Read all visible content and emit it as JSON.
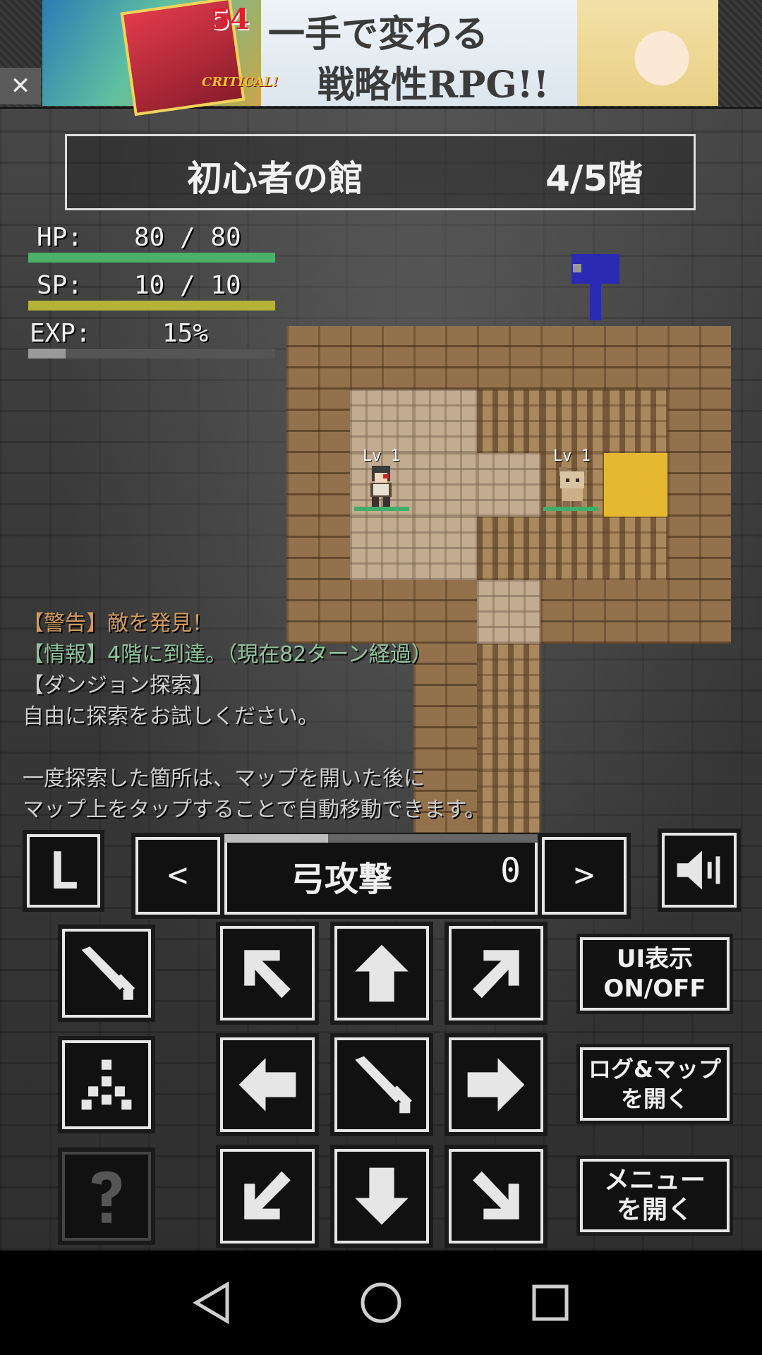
{
  "ad": {
    "badge": "54",
    "critical": "CRITICAL!",
    "line1": "一手で変わる",
    "line2": "戦略性RPG!!",
    "close": "✕"
  },
  "floor": {
    "name": "初心者の館",
    "count": "4/5階"
  },
  "stats": {
    "hp": {
      "label": "HP:",
      "value": "80 / 80",
      "fraction": 1.0,
      "color": "#4caf6a"
    },
    "sp": {
      "label": "SP:",
      "value": "10 / 10",
      "fraction": 1.0,
      "color": "#b5b23a"
    },
    "exp": {
      "label": "EXP:",
      "value": "15%",
      "fraction": 0.15,
      "color": "#9a9a9a"
    }
  },
  "units": {
    "player_level": "Lv 1",
    "enemy_level": "Lv 1"
  },
  "log": [
    {
      "text": "【警告】敵を発見！",
      "color": "#d29a5c"
    },
    {
      "text": "【情報】4階に到達。（現在82ターン経過）",
      "color": "#8fc49a"
    },
    {
      "text": "【ダンジョン探索】",
      "color": "#cfcfcf"
    },
    {
      "text": "自由に探索をお試しください。",
      "color": "#cfcfcf"
    },
    {
      "text": "",
      "color": "#cfcfcf"
    },
    {
      "text": "一度探索した箇所は、マップを開いた後に",
      "color": "#cfcfcf"
    },
    {
      "text": "マップ上をタップすることで自動移動できます。",
      "color": "#cfcfcf"
    }
  ],
  "controls": {
    "l_label": "L",
    "prev": "<",
    "next": ">",
    "skill_name": "弓攻撃",
    "skill_count": "0",
    "skill_progress": 0.33,
    "ui_toggle": [
      "UI表示",
      "ON/OFF"
    ],
    "log_map": [
      "ログ&マップ",
      "を開く"
    ],
    "menu": [
      "メニュー",
      "を開く"
    ]
  },
  "icons": {
    "attack": "sword-icon",
    "skill": "burst-icon",
    "help": "question-icon",
    "sound": "speaker-icon"
  }
}
